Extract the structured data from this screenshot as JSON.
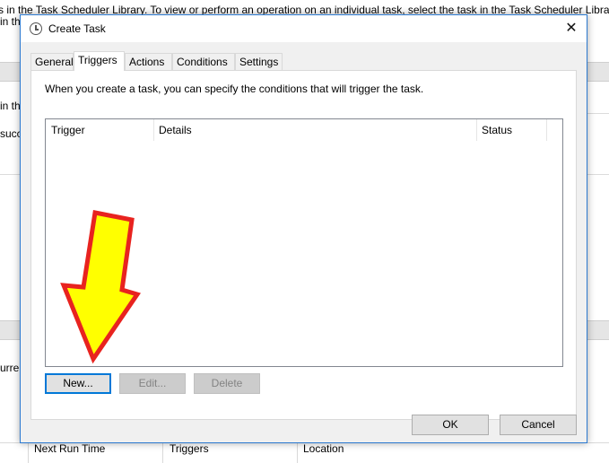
{
  "background": {
    "top_text_left": "s in the Task Scheduler Library. To view or perform an operation on an individual task, select the task in the Task Scheduler Library",
    "line2_left": "in th",
    "snippet_in_th": "in th",
    "snippet_succ": "succ",
    "snippet_curren": "urren",
    "bottom_columns": [
      "Next Run Time",
      "Triggers",
      "Location"
    ]
  },
  "dialog": {
    "title": "Create Task",
    "close_glyph": "✕",
    "tabs": [
      {
        "label": "General",
        "active": false
      },
      {
        "label": "Triggers",
        "active": true
      },
      {
        "label": "Actions",
        "active": false
      },
      {
        "label": "Conditions",
        "active": false
      },
      {
        "label": "Settings",
        "active": false
      }
    ],
    "triggers": {
      "intro": "When you create a task, you can specify the conditions that will trigger the task.",
      "columns": [
        "Trigger",
        "Details",
        "Status"
      ],
      "rows": [],
      "buttons": {
        "new": "New...",
        "edit": "Edit...",
        "delete": "Delete"
      }
    },
    "footer": {
      "ok": "OK",
      "cancel": "Cancel"
    }
  },
  "annotation": {
    "arrow_fill": "#ffff00",
    "arrow_stroke": "#e8231f",
    "arrow_icon": "down-arrow-annotation"
  }
}
